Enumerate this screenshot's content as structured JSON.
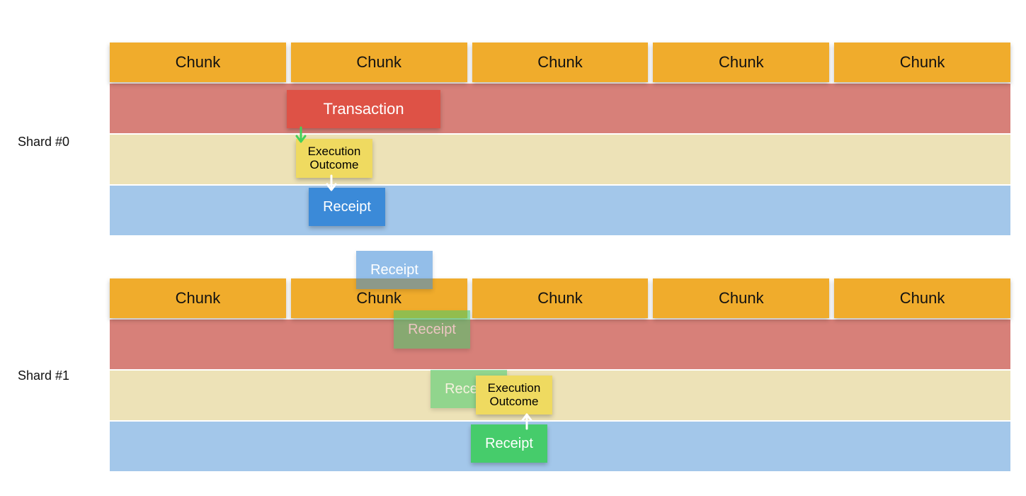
{
  "shards": {
    "0": {
      "label": "Shard #0"
    },
    "1": {
      "label": "Shard #1"
    }
  },
  "chunk_label": "Chunk",
  "boxes": {
    "transaction": "Transaction",
    "execution_line1": "Execution",
    "execution_line2": "Outcome",
    "receipt": "Receipt"
  },
  "colors": {
    "chunk": "#f0ac2c",
    "row_red": "#d78079",
    "row_yellow": "#ede2b7",
    "row_blue": "#a3c7ea",
    "transaction": "#de5246",
    "exec": "#efda60",
    "receipt_blue": "#3b8ad8",
    "receipt_green": "#46cc6b",
    "arrow_green": "#43d15a",
    "arrow_white": "#ffffff"
  }
}
